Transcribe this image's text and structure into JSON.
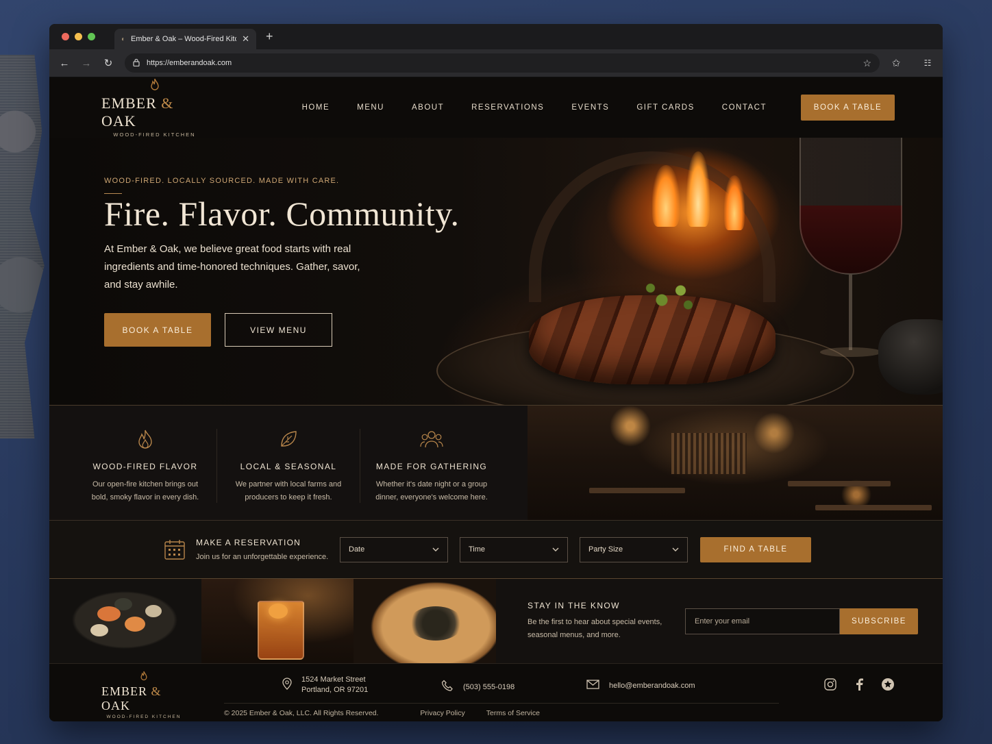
{
  "browser": {
    "tab_title": "Ember & Oak – Wood-Fired Kitchen",
    "url": "https://emberandoak.com",
    "dot_colors": [
      "#ed6a5e",
      "#f5bf4f",
      "#61c554"
    ]
  },
  "brand": {
    "name_part1": "EMBER",
    "amp": "&",
    "name_part2": "OAK",
    "tagline": "WOOD-FIRED KITCHEN",
    "accent": "#a86f2e"
  },
  "nav": {
    "items": [
      "HOME",
      "MENU",
      "ABOUT",
      "RESERVATIONS",
      "EVENTS",
      "GIFT CARDS",
      "CONTACT"
    ],
    "cta": "BOOK A TABLE"
  },
  "hero": {
    "eyebrow": "WOOD-FIRED. LOCALLY SOURCED. MADE WITH CARE.",
    "title": "Fire. Flavor. Community.",
    "text": "At Ember & Oak, we believe great food starts with real ingredients and time-honored techniques. Gather, savor, and stay awhile.",
    "primary_button": "BOOK A TABLE",
    "secondary_button": "VIEW MENU"
  },
  "features": [
    {
      "icon": "flame-icon",
      "title": "WOOD-FIRED FLAVOR",
      "text": "Our open-fire kitchen brings out bold, smoky flavor in every dish."
    },
    {
      "icon": "leaf-icon",
      "title": "LOCAL & SEASONAL",
      "text": "We partner with local farms and producers to keep it fresh."
    },
    {
      "icon": "group-icon",
      "title": "MADE FOR GATHERING",
      "text": "Whether it's date night or a group dinner, everyone's welcome here."
    }
  ],
  "reservation": {
    "title": "MAKE A RESERVATION",
    "subtitle": "Join us for an unforgettable experience.",
    "date": "Date",
    "time": "Time",
    "party": "Party Size",
    "button": "FIND A TABLE"
  },
  "newsletter": {
    "title": "STAY IN THE KNOW",
    "text": "Be the first to hear about special events, seasonal menus, and more.",
    "placeholder": "Enter your email",
    "button": "SUBSCRIBE"
  },
  "footer": {
    "address_line1": "1524 Market Street",
    "address_line2": "Portland, OR 97201",
    "phone": "(503) 555-0198",
    "email": "hello@emberandoak.com",
    "copyright": "© 2025 Ember & Oak, LLC. All Rights Reserved.",
    "privacy": "Privacy Policy",
    "terms": "Terms of Service",
    "social": [
      "instagram-icon",
      "facebook-icon",
      "yelp-icon"
    ]
  }
}
